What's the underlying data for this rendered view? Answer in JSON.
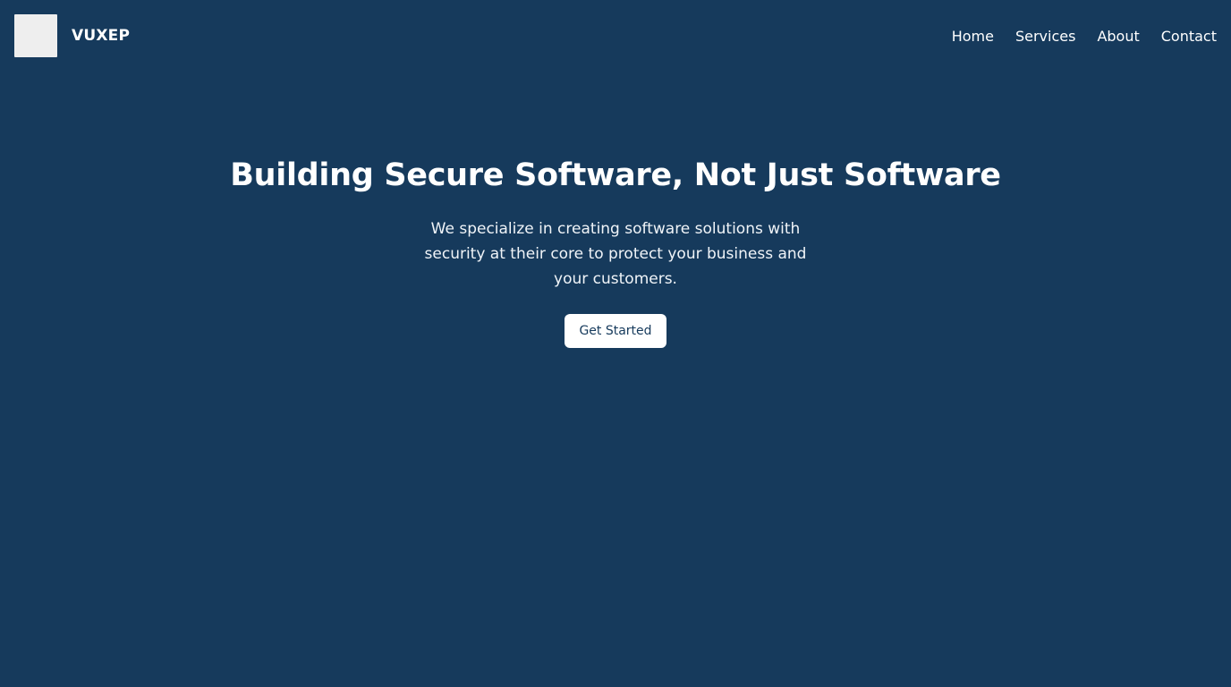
{
  "header": {
    "brand_name": "VUXEP",
    "nav": [
      {
        "label": "Home"
      },
      {
        "label": "Services"
      },
      {
        "label": "About"
      },
      {
        "label": "Contact"
      }
    ]
  },
  "hero": {
    "title": "Building Secure Software, Not Just Software",
    "subtitle": "We specialize in creating software solutions with security at their core to protect your business and your customers.",
    "cta_label": "Get Started"
  },
  "colors": {
    "background": "#163a5c",
    "text": "#ffffff",
    "logo_placeholder": "#eeeeee",
    "button_bg": "#ffffff",
    "button_text": "#163a5c"
  }
}
